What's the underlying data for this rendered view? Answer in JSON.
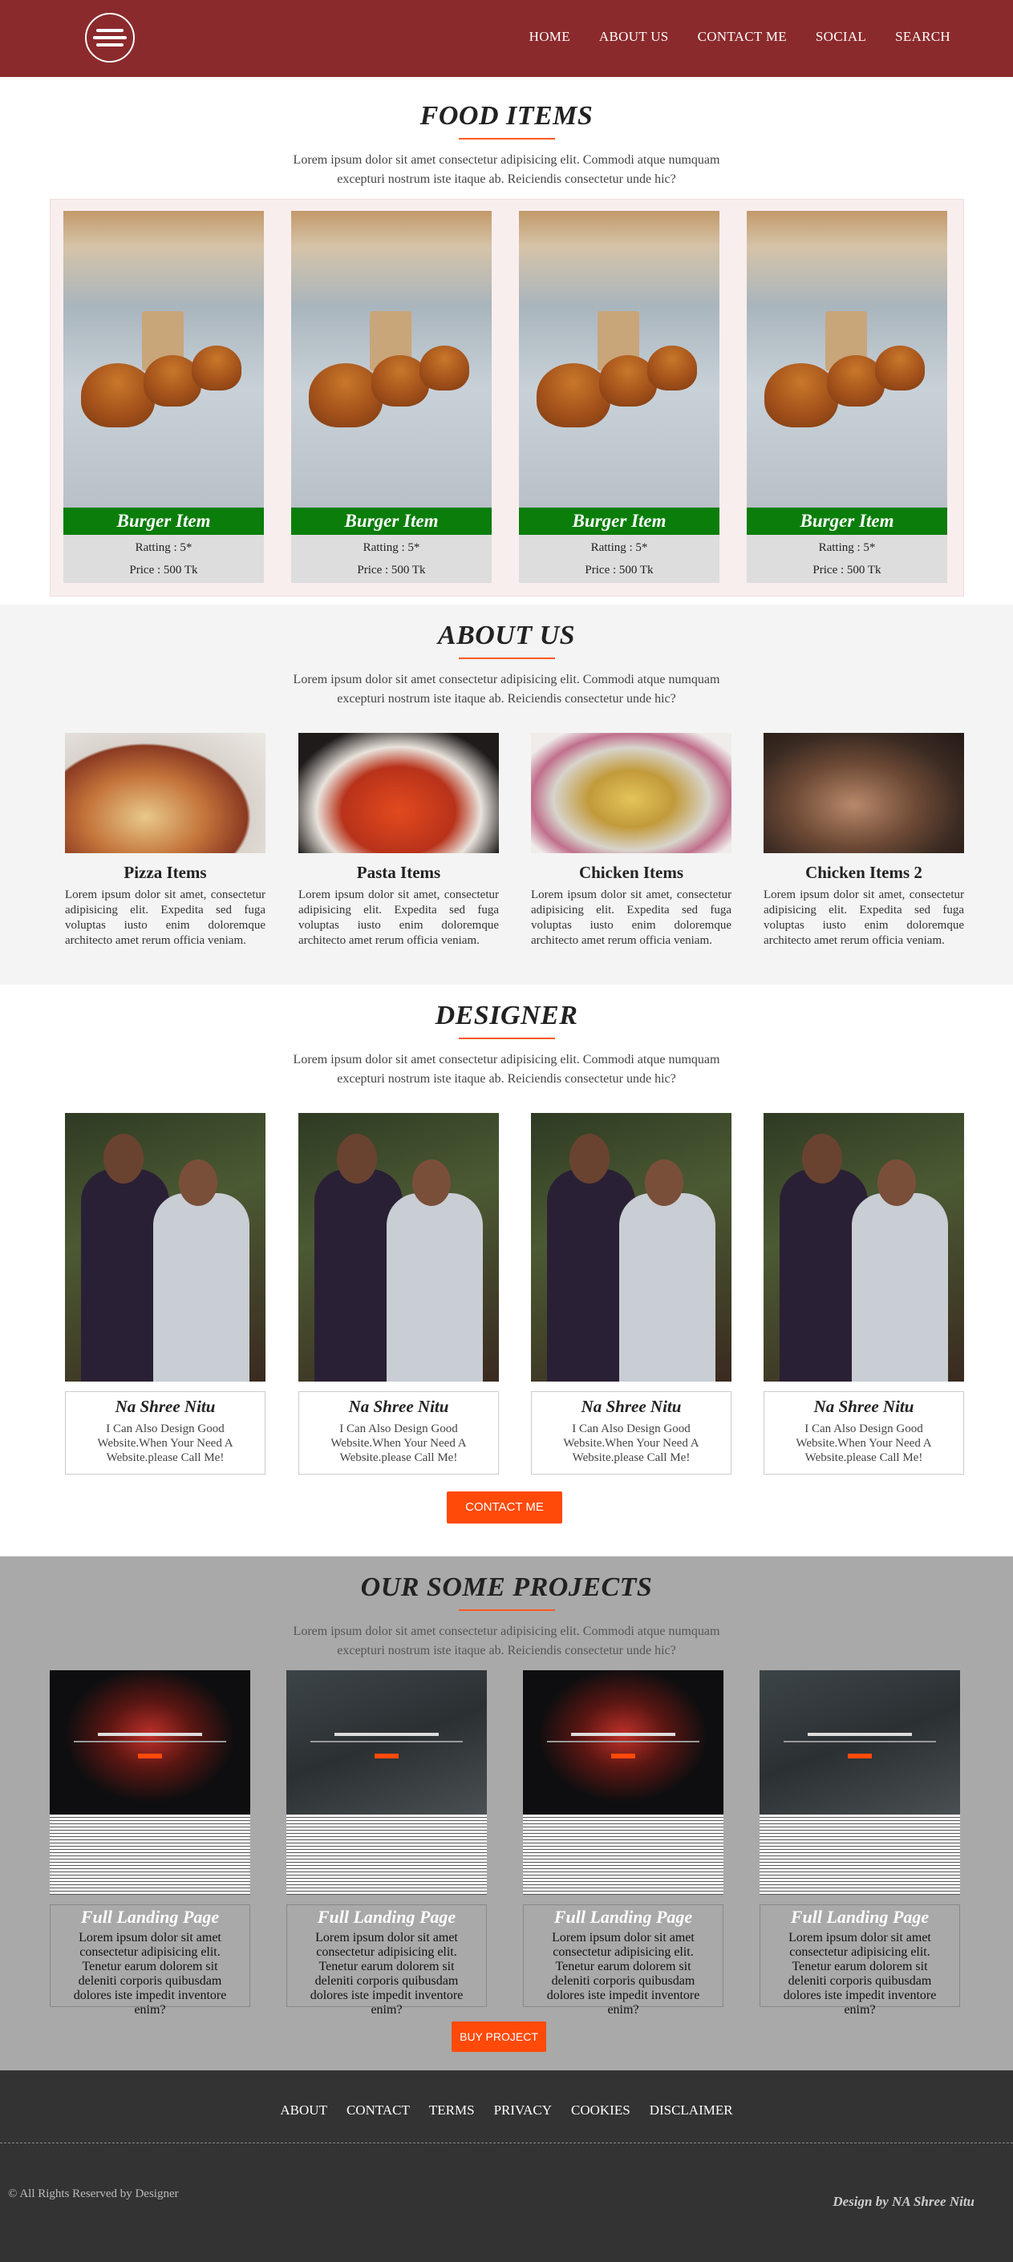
{
  "nav": {
    "items": [
      {
        "label": "HOME"
      },
      {
        "label": "ABOUT US"
      },
      {
        "label": "CONTACT ME"
      },
      {
        "label": "SOCIAL"
      },
      {
        "label": "SEARCH"
      }
    ]
  },
  "intro_text": "Lorem ipsum dolor sit amet consectetur adipisicing elit. Commodi atque numquam excepturi nostrum iste itaque ab. Reiciendis consectetur unde hic?",
  "food": {
    "title": "FOOD ITEMS",
    "cards": [
      {
        "name": "Burger Item",
        "rating": "Ratting : 5*",
        "price": "Price : 500 Tk"
      },
      {
        "name": "Burger Item",
        "rating": "Ratting : 5*",
        "price": "Price : 500 Tk"
      },
      {
        "name": "Burger Item",
        "rating": "Ratting : 5*",
        "price": "Price : 500 Tk"
      },
      {
        "name": "Burger Item",
        "rating": "Ratting : 5*",
        "price": "Price : 500 Tk"
      }
    ]
  },
  "about": {
    "title": "ABOUT US",
    "cards": [
      {
        "name": "Pizza Items",
        "text": "Lorem ipsum dolor sit amet, consectetur adipisicing elit. Expedita sed fuga voluptas iusto enim doloremque architecto amet rerum officia veniam."
      },
      {
        "name": "Pasta Items",
        "text": "Lorem ipsum dolor sit amet, consectetur adipisicing elit. Expedita sed fuga voluptas iusto enim doloremque architecto amet rerum officia veniam."
      },
      {
        "name": "Chicken Items",
        "text": "Lorem ipsum dolor sit amet, consectetur adipisicing elit. Expedita sed fuga voluptas iusto enim doloremque architecto amet rerum officia veniam."
      },
      {
        "name": "Chicken Items 2",
        "text": "Lorem ipsum dolor sit amet, consectetur adipisicing elit. Expedita sed fuga voluptas iusto enim doloremque architecto amet rerum officia veniam."
      }
    ]
  },
  "designer": {
    "title": "DESIGNER",
    "cards": [
      {
        "name": "Na Shree Nitu",
        "text": "I Can Also Design Good Website.When Your Need A Website.please Call Me!"
      },
      {
        "name": "Na Shree Nitu",
        "text": "I Can Also Design Good Website.When Your Need A Website.please Call Me!"
      },
      {
        "name": "Na Shree Nitu",
        "text": "I Can Also Design Good Website.When Your Need A Website.please Call Me!"
      },
      {
        "name": "Na Shree Nitu",
        "text": "I Can Also Design Good Website.When Your Need A Website.please Call Me!"
      }
    ],
    "button": "CONTACT ME"
  },
  "projects": {
    "title": "OUR SOME PROJECTS",
    "cards": [
      {
        "name": "Full Landing Page",
        "text": "Lorem ipsum dolor sit amet consectetur adipisicing elit. Tenetur earum dolorem sit deleniti corporis quibusdam dolores iste impedit inventore enim?"
      },
      {
        "name": "Full Landing Page",
        "text": "Lorem ipsum dolor sit amet consectetur adipisicing elit. Tenetur earum dolorem sit deleniti corporis quibusdam dolores iste impedit inventore enim?"
      },
      {
        "name": "Full Landing Page",
        "text": "Lorem ipsum dolor sit amet consectetur adipisicing elit. Tenetur earum dolorem sit deleniti corporis quibusdam dolores iste impedit inventore enim?"
      },
      {
        "name": "Full Landing Page",
        "text": "Lorem ipsum dolor sit amet consectetur adipisicing elit. Tenetur earum dolorem sit deleniti corporis quibusdam dolores iste impedit inventore enim?"
      }
    ],
    "button": "BUY PROJECT"
  },
  "footer": {
    "links": [
      {
        "label": "ABOUT"
      },
      {
        "label": "CONTACT"
      },
      {
        "label": "TERMS"
      },
      {
        "label": "PRIVACY"
      },
      {
        "label": "COOKIES"
      },
      {
        "label": "DISCLAIMER"
      }
    ],
    "copyright": "© All Rights Reserved by Designer",
    "credit": "Design by NA Shree Nitu"
  },
  "colors": {
    "nav_bg": "#8b2a2c",
    "accent": "#ff4a0a",
    "green_label": "#0a7d0a",
    "projects_bg": "#a9a9a9",
    "footer_bg": "#333333"
  }
}
